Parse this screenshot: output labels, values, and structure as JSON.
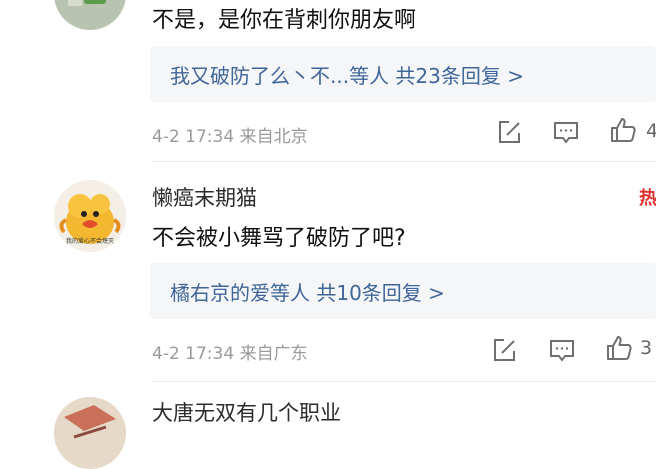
{
  "comments": [
    {
      "content": "不是，是你在背刺你朋友啊",
      "reply_link": "我又破防了么丶不...等人  共23条回复 >",
      "meta": "4-2 17:34 来自北京"
    },
    {
      "username": "懒癌末期猫",
      "hot_label": "热",
      "avatar_text": "我的爱心不会熄灭",
      "content": "不会被小舞骂了破防了吧?",
      "reply_link": "橘右京的爱等人  共10条回复 >",
      "meta": "4-2 17:34 来自广东",
      "like_count": "3"
    },
    {
      "username": "大唐无双有几个职业"
    }
  ],
  "icons": [
    "edit-icon",
    "comment-icon",
    "thumbs-up-icon"
  ],
  "colors": {
    "reply_link": "#406599",
    "reply_bg": "#f5f6f8",
    "meta": "#9a9a9a",
    "hot": "#e0312e"
  }
}
